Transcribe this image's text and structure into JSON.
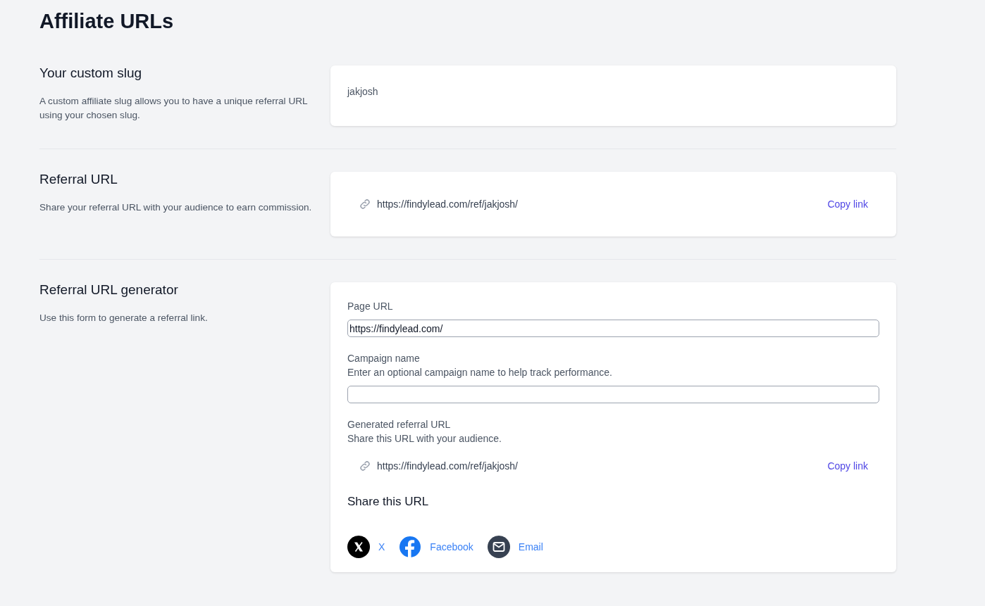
{
  "page_title": "Affiliate URLs",
  "slug_section": {
    "title": "Your custom slug",
    "description": "A custom affiliate slug allows you to have a unique referral URL using your chosen slug.",
    "slug": "jakjosh"
  },
  "referral_section": {
    "title": "Referral URL",
    "description": "Share your referral URL with your audience to earn commission.",
    "url": "https://findylead.com/ref/jakjosh/",
    "copy_label": "Copy link"
  },
  "generator_section": {
    "title": "Referral URL generator",
    "description": "Use this form to generate a referral link.",
    "page_url": {
      "label": "Page URL",
      "value": "https://findylead.com/"
    },
    "campaign": {
      "label": "Campaign name",
      "hint": "Enter an optional campaign name to help track performance."
    },
    "generated": {
      "label": "Generated referral URL",
      "hint": "Share this URL with your audience.",
      "url": "https://findylead.com/ref/jakjosh/",
      "copy_label": "Copy link"
    },
    "share_title": "Share this URL",
    "share_links": [
      {
        "kind": "x",
        "label": "X"
      },
      {
        "kind": "facebook",
        "label": "Facebook"
      },
      {
        "kind": "email",
        "label": "Email"
      }
    ]
  }
}
